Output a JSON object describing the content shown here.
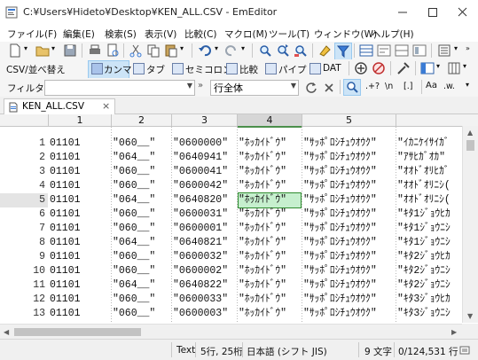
{
  "window": {
    "title": "C:¥Users¥Hideto¥Desktop¥KEN_ALL.CSV - EmEditor"
  },
  "menu": [
    "ファイル(F)",
    "編集(E)",
    "検索(S)",
    "表示(V)",
    "比較(C)",
    "マクロ(M)",
    "ツール(T)",
    "ウィンドウ(W)",
    "ヘルプ(H)"
  ],
  "csvbar": {
    "csv_label": "CSV/並べ替え",
    "comma_label": "カンマ",
    "tab_label": "タブ",
    "semicolon_label": "セミコロン",
    "compare_label": "比較",
    "pipe_label": "パイプ",
    "dat_label": "DAT"
  },
  "filterbar": {
    "label": "フィルター:",
    "filter_value": "",
    "scope_value": "行全体",
    "opt_regex": ".+?",
    "opt_newline": "\\n",
    "opt_brackets": "[.]",
    "opt_case": "Aa",
    "opt_word": ".w."
  },
  "tab": {
    "filename": "KEN_ALL.CSV",
    "close": "×"
  },
  "grid": {
    "columns": [
      "1",
      "2",
      "3",
      "4",
      "5"
    ],
    "selected_column": "4",
    "active_cell": {
      "row": "5",
      "column": "4"
    },
    "rows": [
      {
        "num": "1",
        "cells": [
          "01101",
          "\"060__\"",
          "\"0600000\"",
          "\"ﾎｯｶｲﾄﾞｳ\"",
          "\"ｻｯﾎﾟﾛｼﾁｭｳｵｳｸ\"",
          "\"ｲｶﾆｹｲｻｲｶﾞ"
        ]
      },
      {
        "num": "2",
        "cells": [
          "01101",
          "\"064__\"",
          "\"0640941\"",
          "\"ﾎｯｶｲﾄﾞｳ\"",
          "\"ｻｯﾎﾟﾛｼﾁｭｳｵｳｸ\"",
          "\"ｱｻﾋｶﾞｵｶ\""
        ]
      },
      {
        "num": "3",
        "cells": [
          "01101",
          "\"060__\"",
          "\"0600041\"",
          "\"ﾎｯｶｲﾄﾞｳ\"",
          "\"ｻｯﾎﾟﾛｼﾁｭｳｵｳｸ\"",
          "\"ｵｵﾄﾞｵﾘﾋｶﾞ"
        ]
      },
      {
        "num": "4",
        "cells": [
          "01101",
          "\"060__\"",
          "\"0600042\"",
          "\"ﾎｯｶｲﾄﾞｳ\"",
          "\"ｻｯﾎﾟﾛｼﾁｭｳｵｳｸ\"",
          "\"ｵｵﾄﾞｵﾘﾆｼ("
        ]
      },
      {
        "num": "5",
        "cells": [
          "01101",
          "\"064__\"",
          "\"0640820\"",
          "\"ﾎｯｶｲﾄﾞｳ\"",
          "\"ｻｯﾎﾟﾛｼﾁｭｳｵｳｸ\"",
          "\"ｵｵﾄﾞｵﾘﾆｼ("
        ]
      },
      {
        "num": "6",
        "cells": [
          "01101",
          "\"060__\"",
          "\"0600031\"",
          "\"ﾎｯｶｲﾄﾞｳ\"",
          "\"ｻｯﾎﾟﾛｼﾁｭｳｵｳｸ\"",
          "\"ｷﾀ1ｼﾞｮｳﾋｶ"
        ]
      },
      {
        "num": "7",
        "cells": [
          "01101",
          "\"060__\"",
          "\"0600001\"",
          "\"ﾎｯｶｲﾄﾞｳ\"",
          "\"ｻｯﾎﾟﾛｼﾁｭｳｵｳｸ\"",
          "\"ｷﾀ1ｼﾞｮｳﾆｼ"
        ]
      },
      {
        "num": "8",
        "cells": [
          "01101",
          "\"064__\"",
          "\"0640821\"",
          "\"ﾎｯｶｲﾄﾞｳ\"",
          "\"ｻｯﾎﾟﾛｼﾁｭｳｵｳｸ\"",
          "\"ｷﾀ1ｼﾞｮｳﾆｼ"
        ]
      },
      {
        "num": "9",
        "cells": [
          "01101",
          "\"060__\"",
          "\"0600032\"",
          "\"ﾎｯｶｲﾄﾞｳ\"",
          "\"ｻｯﾎﾟﾛｼﾁｭｳｵｳｸ\"",
          "\"ｷﾀ2ｼﾞｮｳﾋｶ"
        ]
      },
      {
        "num": "10",
        "cells": [
          "01101",
          "\"060__\"",
          "\"0600002\"",
          "\"ﾎｯｶｲﾄﾞｳ\"",
          "\"ｻｯﾎﾟﾛｼﾁｭｳｵｳｸ\"",
          "\"ｷﾀ2ｼﾞｮｳﾆｼ"
        ]
      },
      {
        "num": "11",
        "cells": [
          "01101",
          "\"064__\"",
          "\"0640822\"",
          "\"ﾎｯｶｲﾄﾞｳ\"",
          "\"ｻｯﾎﾟﾛｼﾁｭｳｵｳｸ\"",
          "\"ｷﾀ2ｼﾞｮｳﾆｼ"
        ]
      },
      {
        "num": "12",
        "cells": [
          "01101",
          "\"060__\"",
          "\"0600033\"",
          "\"ﾎｯｶｲﾄﾞｳ\"",
          "\"ｻｯﾎﾟﾛｼﾁｭｳｵｳｸ\"",
          "\"ｷﾀ3ｼﾞｮｳﾋｶ"
        ]
      },
      {
        "num": "13",
        "cells": [
          "01101",
          "\"060__\"",
          "\"0600003\"",
          "\"ﾎｯｶｲﾄﾞｳ\"",
          "\"ｻｯﾎﾟﾛｼﾁｭｳｵｳｸ\"",
          "\"ｷﾀ3ｼﾞｮｳﾆｼ"
        ]
      }
    ]
  },
  "status": {
    "mode": "Text",
    "position": "5行, 25桁",
    "encoding": "日本語 (シフト JIS)",
    "chars": "9 文字",
    "progress": "0/124,531 行"
  },
  "colors": {
    "active_cell_bg": "#c6efce",
    "selected_column_underline": "#4b8f4b"
  }
}
